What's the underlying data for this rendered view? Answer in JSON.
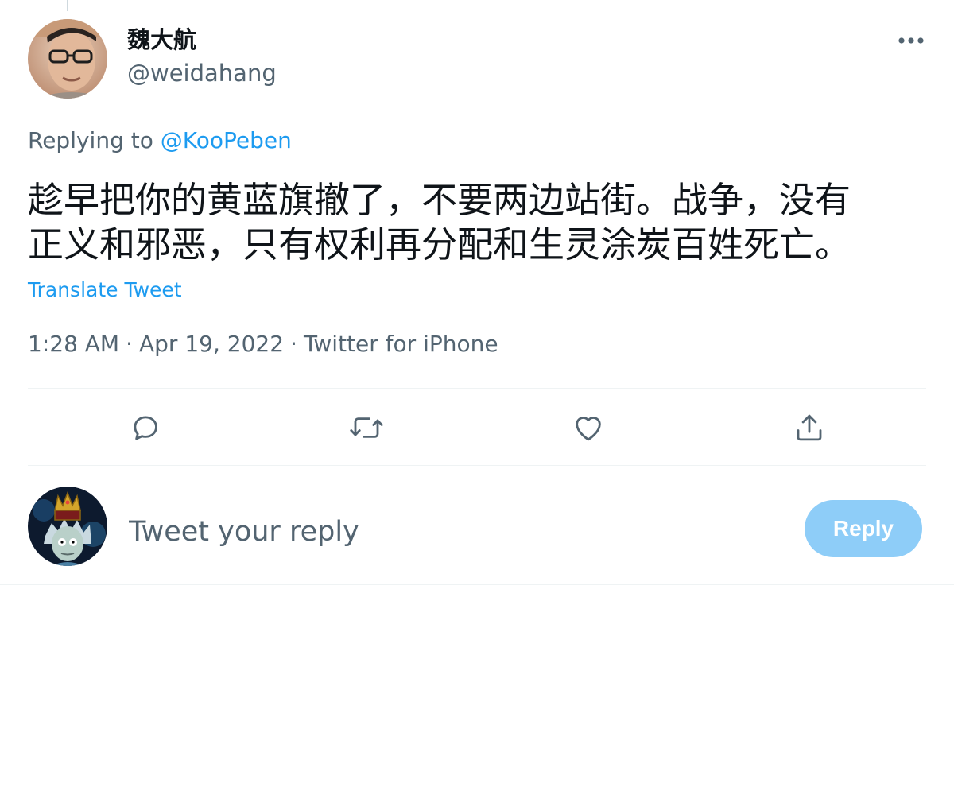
{
  "author": {
    "display_name": "魏大航",
    "handle": "@weidahang",
    "avatar_icon": "author-avatar"
  },
  "replying": {
    "prefix": "Replying to",
    "handle": "@KooPeben"
  },
  "tweet": {
    "lines": [
      "趁早把你的黄蓝旗撤了，不要两边站街。战争，没有",
      "正义和邪恶，只有权利再分配和生灵涂炭百姓死亡。"
    ],
    "translate_label": "Translate Tweet",
    "time": "1:28 AM",
    "date": "Apr 19, 2022",
    "source": "Twitter for iPhone",
    "separator": "·"
  },
  "actions": {
    "reply_icon": "reply-icon",
    "retweet_icon": "retweet-icon",
    "like_icon": "heart-icon",
    "share_icon": "share-icon",
    "more_icon": "more-icon"
  },
  "composer": {
    "placeholder": "Tweet your reply",
    "button_label": "Reply",
    "avatar_icon": "user-avatar"
  },
  "colors": {
    "text_primary": "#0f1419",
    "text_secondary": "#536471",
    "accent": "#1d9bf0",
    "button_disabled": "#8ecdf8",
    "divider": "#eff3f4"
  }
}
